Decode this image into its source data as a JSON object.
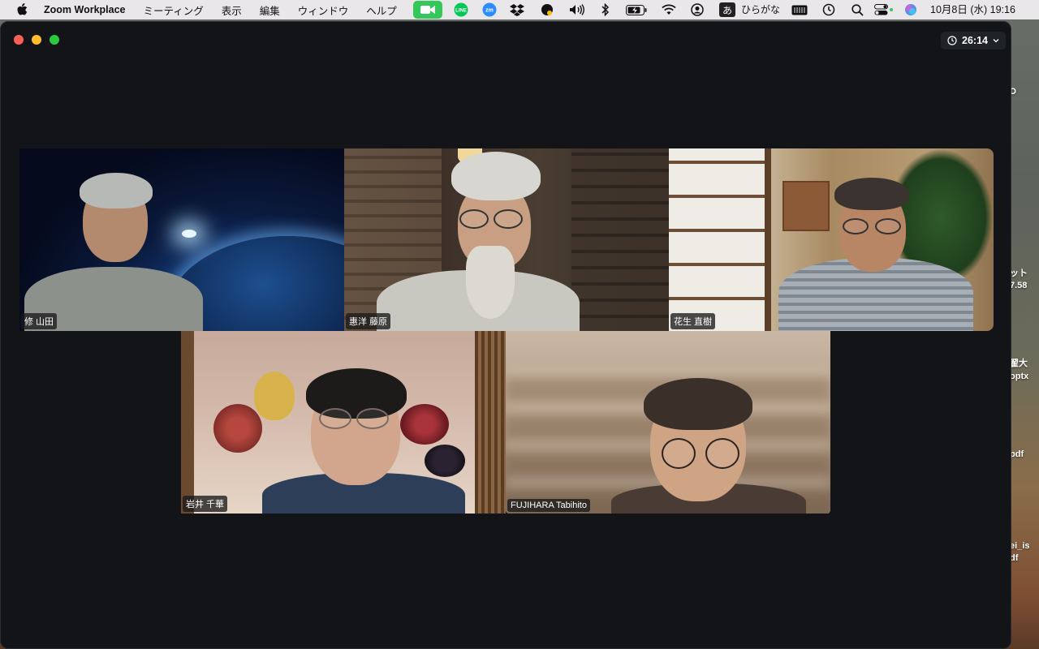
{
  "menubar": {
    "app_name": "Zoom Workplace",
    "menus": [
      "ミーティング",
      "表示",
      "編集",
      "ウィンドウ",
      "ヘルプ"
    ],
    "tray_icons": [
      "facetime-icon",
      "line-icon",
      "zoom-tray-icon",
      "dropbox-icon",
      "scripts-icon",
      "volume-icon",
      "bluetooth-icon",
      "battery-icon",
      "wifi-icon",
      "user-icon",
      "input-method-icon",
      "keyboard-icon",
      "time-machine-icon",
      "search-icon",
      "control-center-icon",
      "siri-icon"
    ],
    "tray_line_label": "LINE",
    "tray_zoom_label": "zm",
    "ime_char": "あ",
    "ime_label": "ひらがな",
    "clock": "10月8日 (水)  19:16"
  },
  "window": {
    "timer": "26:14"
  },
  "participants": [
    {
      "name": "修 山田",
      "active": false
    },
    {
      "name": "惠洋 藤原",
      "active": false
    },
    {
      "name": "花生 直樹",
      "active": false
    },
    {
      "name": "岩井 千華",
      "active": false
    },
    {
      "name": "FUJIHARA Tabihito",
      "active": true
    }
  ],
  "desktop_labels": [
    "D",
    "ット",
    "7.58",
    "翟大",
    "optx",
    "pdf",
    "ei_is",
    "df"
  ],
  "colors": {
    "active_border": "#2ac15a",
    "window_bg": "#121417",
    "facetime_green": "#34c759"
  }
}
